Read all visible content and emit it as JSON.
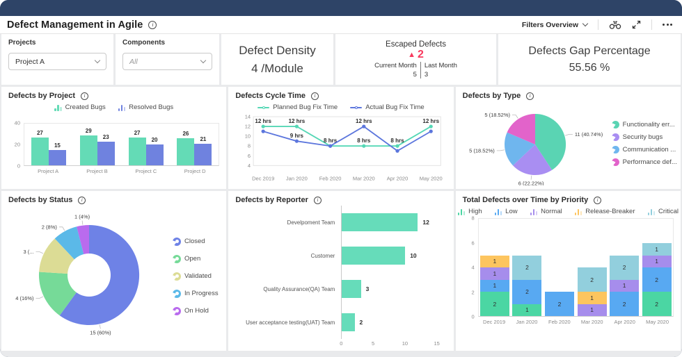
{
  "header": {
    "title": "Defect Management in Agile",
    "filters_label": "Filters Overview"
  },
  "filters": {
    "projects": {
      "label": "Projects",
      "value": "Project A"
    },
    "components": {
      "label": "Components",
      "value": "All"
    }
  },
  "kpis": {
    "defect_density": {
      "title": "Defect Density",
      "value": "4 /Module"
    },
    "escaped": {
      "title": "Escaped Defects",
      "delta_icon": "▲",
      "delta": "2",
      "delta_color": "#f8395d",
      "current_label": "Current Month",
      "current_value": "5",
      "last_label": "Last Month",
      "last_value": "3"
    },
    "gap": {
      "title": "Defects Gap Percentage",
      "value": "55.56 %"
    }
  },
  "chart_data": [
    {
      "id": "defects_by_project",
      "type": "bar",
      "title": "Defects by Project",
      "categories": [
        "Project A",
        "Project B",
        "Project C",
        "Project D"
      ],
      "series": [
        {
          "name": "Created Bugs",
          "color": "#64dbb6",
          "values": [
            27,
            29,
            27,
            26
          ]
        },
        {
          "name": "Resolved Bugs",
          "color": "#6f82df",
          "values": [
            15,
            23,
            20,
            21
          ]
        }
      ],
      "ylim": [
        0,
        40
      ],
      "yticks": [
        0,
        20,
        40
      ],
      "legend_position": "top"
    },
    {
      "id": "defects_cycle_time",
      "type": "line",
      "title": "Defects Cycle Time",
      "x": [
        "Dec 2019",
        "Jan 2020",
        "Feb 2020",
        "Mar 2020",
        "Apr 2020",
        "May 2020"
      ],
      "series": [
        {
          "name": "Planned Bug Fix Time",
          "color": "#55d7b5",
          "values": [
            12,
            12,
            8,
            8,
            8,
            12
          ],
          "labels": [
            "12 hrs",
            "12 hrs",
            "8 hrs",
            "8 hrs",
            "8 hrs",
            "12 hrs"
          ]
        },
        {
          "name": "Actual Bug Fix Time",
          "color": "#5c76dd",
          "values": [
            11,
            9,
            8,
            12,
            7,
            11
          ],
          "labels": [
            "",
            "9 hrs",
            "",
            "12 hrs",
            "",
            ""
          ]
        }
      ],
      "ylim": [
        4,
        14
      ],
      "yticks": [
        4,
        6,
        8,
        10,
        12,
        14
      ],
      "legend_position": "top"
    },
    {
      "id": "defects_by_type",
      "type": "pie",
      "title": "Defects by Type",
      "slices": [
        {
          "label": "Functionality err...",
          "value": 11,
          "pct": "40.74%",
          "text": "11 (40.74%)",
          "color": "#5ad4b3"
        },
        {
          "label": "Security bugs",
          "value": 6,
          "pct": "22.22%",
          "text": "6 (22.22%)",
          "color": "#a98ef2"
        },
        {
          "label": "Communication ...",
          "value": 5,
          "pct": "18.52%",
          "text": "5 (18.52%)",
          "color": "#6fb6ee"
        },
        {
          "label": "Performance def...",
          "value": 5,
          "pct": "18.52%",
          "text": "5 (18.52%)",
          "color": "#e263ca"
        }
      ],
      "legend_position": "right"
    },
    {
      "id": "defects_by_status",
      "type": "donut",
      "title": "Defects by Status",
      "slices": [
        {
          "label": "Closed",
          "value": 15,
          "pct": "60%",
          "text": "15 (60%)",
          "color": "#6e82e6",
          "label_angle": 168
        },
        {
          "label": "Open",
          "value": 4,
          "pct": "16%",
          "text": "4 (16%)",
          "color": "#76da98"
        },
        {
          "label": "Validated",
          "value": 3,
          "pct": "12%",
          "text": "3 (...",
          "color": "#dcdc95"
        },
        {
          "label": "In Progress",
          "value": 2,
          "pct": "8%",
          "text": "2 (8%)",
          "color": "#5bb9e8"
        },
        {
          "label": "On Hold",
          "value": 1,
          "pct": "4%",
          "text": "1 (4%)",
          "color": "#b96bee"
        }
      ],
      "legend_position": "right"
    },
    {
      "id": "defects_by_reporter",
      "type": "hbar",
      "title": "Defects by Reporter",
      "categories": [
        "Develpoment Team",
        "Customer",
        "Quality Assurance(QA) Team",
        "User acceptance testing(UAT) Team"
      ],
      "values": [
        12,
        10,
        3,
        2
      ],
      "color": "#66dcba",
      "xlim": [
        0,
        15
      ],
      "xticks": [
        0,
        5,
        10,
        15
      ]
    },
    {
      "id": "total_defects_over_time_by_priority",
      "type": "stacked_bar",
      "title": "Total Defects over Time by Priority",
      "categories": [
        "Dec 2019",
        "Jan 2020",
        "Feb 2020",
        "Mar 2020",
        "Apr 2020",
        "May 2020"
      ],
      "series": [
        {
          "name": "High",
          "color": "#4bd6a3",
          "values": [
            2,
            1,
            0,
            0,
            0,
            2
          ]
        },
        {
          "name": "Low",
          "color": "#58a9f2",
          "values": [
            1,
            2,
            2,
            0,
            2,
            2
          ]
        },
        {
          "name": "Normal",
          "color": "#a68dec",
          "values": [
            1,
            0,
            0,
            1,
            1,
            1
          ]
        },
        {
          "name": "Release-Breaker",
          "color": "#fdc55f",
          "values": [
            1,
            0,
            0,
            1,
            0,
            0
          ]
        },
        {
          "name": "Critical",
          "color": "#92cfdd",
          "values": [
            0,
            2,
            0,
            2,
            2,
            1
          ]
        }
      ],
      "ylim": [
        0,
        8
      ],
      "yticks": [
        0,
        2,
        4,
        6,
        8
      ],
      "legend_position": "top"
    }
  ]
}
